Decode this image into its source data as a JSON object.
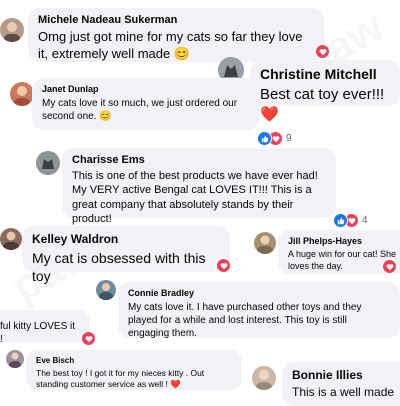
{
  "watermark": "paw",
  "colors": {
    "bubble": "#f0f2f5",
    "love": "#f33e58",
    "like": "#1877f2",
    "text": "#050505"
  },
  "comments": [
    {
      "name": "Michele Nadeau Sukerman",
      "text": "Omg just got mine for my cats so far they love it, extremely well made 😊",
      "reaction": "heart"
    },
    {
      "name": "Christine Mitchell",
      "text": "Best cat toy ever!!! ❤️",
      "reaction": "none"
    },
    {
      "name": "Janet Dunlap",
      "text": "My cats love it so much, we just ordered our second one. 😊",
      "reaction": "like-love",
      "reaction_count": "9"
    },
    {
      "name": "Charisse Ems",
      "text": "This is one of the best products we have ever had! My VERY active Bengal cat LOVES IT!!! This is a great company that absolutely stands by their product!",
      "reaction": "like-love",
      "reaction_count": "4"
    },
    {
      "name": "Kelley Waldron",
      "text": "My cat is obsessed with this toy",
      "reaction": "heart"
    },
    {
      "name": "Jill Phelps-Hayes",
      "text": "A huge win for our cat! She loves the day.",
      "reaction": "heart"
    },
    {
      "name": "",
      "text": "ful kitty LOVES it !",
      "reaction": "heart"
    },
    {
      "name": "Connie Bradley",
      "text": "My cats love it. I have purchased other toys and they played for a while and lost interest. This toy is still engaging them.",
      "reaction": "none"
    },
    {
      "name": "Eve Bisch",
      "text": "The best toy ! I got it for my nieces kitty . Out standing customer service as well ! ❤️",
      "reaction": "none"
    },
    {
      "name": "Bonnie Illies",
      "text": "This is a well made",
      "reaction": "none"
    }
  ]
}
